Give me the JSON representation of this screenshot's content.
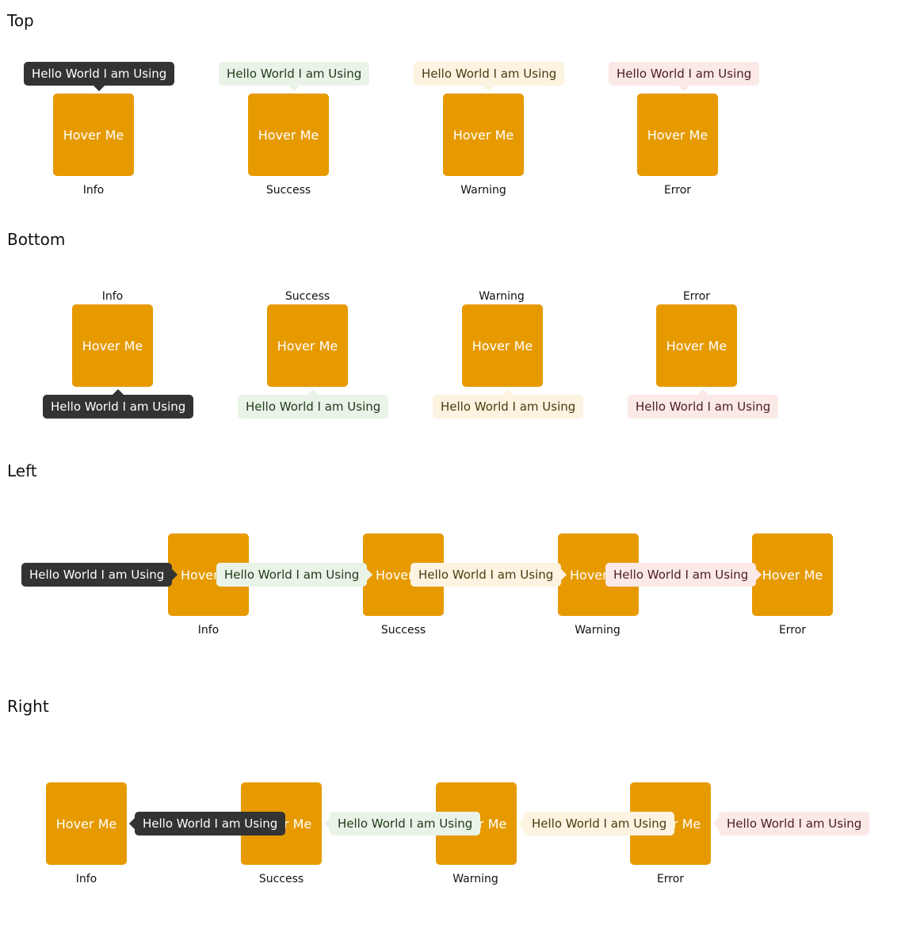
{
  "sections": {
    "top": {
      "title": "Top"
    },
    "bottom": {
      "title": "Bottom"
    },
    "left": {
      "title": "Left"
    },
    "right": {
      "title": "Right"
    }
  },
  "button_label": "Hover Me",
  "tooltip_text": "Hello World I am Using",
  "variants": {
    "info": "Info",
    "success": "Success",
    "warning": "Warning",
    "error": "Error"
  },
  "colors": {
    "button": "#e69a00",
    "info_bg": "#333333",
    "success_bg": "#eaf3e7",
    "warning_bg": "#fcf3e0",
    "error_bg": "#fbe9e8"
  }
}
